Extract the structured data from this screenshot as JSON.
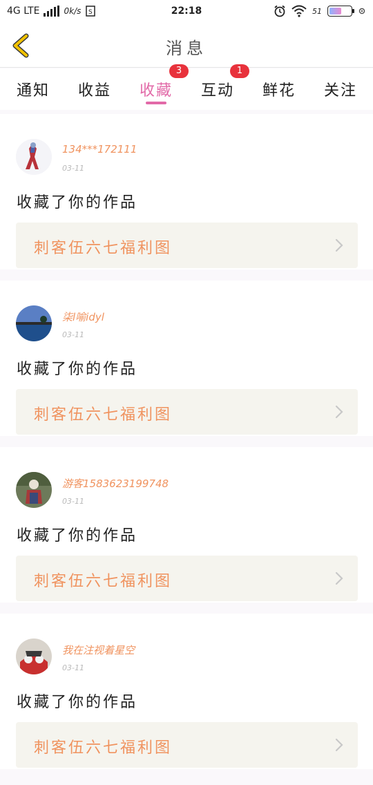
{
  "status_bar": {
    "network": "4G LTE",
    "speed": "0k/s",
    "time": "22:18",
    "battery_percent": "51",
    "icons": [
      "signal-icon",
      "sim-icon",
      "alarm-icon",
      "wifi-icon",
      "battery-icon",
      "settings-icon"
    ]
  },
  "header": {
    "title": "消息",
    "back_icon": "chevron-left-icon"
  },
  "tabs": [
    {
      "label": "通知",
      "badge": ""
    },
    {
      "label": "收益",
      "badge": ""
    },
    {
      "label": "收藏",
      "badge": "3",
      "active": true
    },
    {
      "label": "互动",
      "badge": "1"
    },
    {
      "label": "鲜花",
      "badge": ""
    },
    {
      "label": "关注",
      "badge": ""
    }
  ],
  "messages": [
    {
      "username": "134***172111",
      "date": "03-11",
      "action": "收藏了你的作品",
      "work_title": "刺客伍六七福利图"
    },
    {
      "username": "柒l喻idyl",
      "date": "03-11",
      "action": "收藏了你的作品",
      "work_title": "刺客伍六七福利图"
    },
    {
      "username": "游客1583623199748",
      "date": "03-11",
      "action": "收藏了你的作品",
      "work_title": "刺客伍六七福利图"
    },
    {
      "username": "我在注视着星空",
      "date": "03-11",
      "action": "收藏了你的作品",
      "work_title": "刺客伍六七福利图"
    }
  ],
  "colors": {
    "accent_pink": "#e26aa8",
    "username_orange": "#f0935f",
    "badge_red": "#e8323c",
    "back_yellow": "#f2c200"
  }
}
